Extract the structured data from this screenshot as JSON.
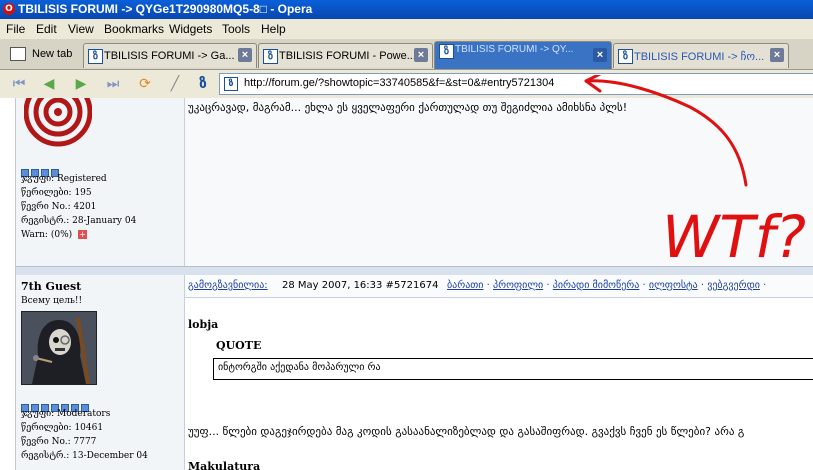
{
  "window": {
    "title": "TBILISIS FORUMI -> QYGe1T290980MQ5-8□ - Opera"
  },
  "menu": [
    "File",
    "Edit",
    "View",
    "Bookmarks",
    "Widgets",
    "Tools",
    "Help"
  ],
  "tabs": {
    "new_tab_label": "New tab",
    "items": [
      {
        "label": "TBILISIS FORUMI -> Ga..."
      },
      {
        "label": "TBILISIS FORUMI - Powe..."
      },
      {
        "label": "TBILISIS FORUMI -> QY..."
      },
      {
        "label": "TBILISIS FORUMI -> ჩო..."
      }
    ]
  },
  "address": {
    "url": "http://forum.ge/?showtopic=33740585&f=&st=0&#entry5721304"
  },
  "post1": {
    "text": "უკაცრავად, მაგრამ... ეხლა ეს ყველაფერი ქართულად თუ შეგიძლია ამიხსნა პლს!",
    "group": "ჯგუფი: Registered",
    "posts": "წერილები: 195",
    "member_no": "წევრი No.: 4201",
    "registered": "რეგისტრ.: 28-January 04",
    "warn": "Warn: (0%)"
  },
  "post2": {
    "username": "7th Guest",
    "user_title": "Всему цель!!",
    "group": "ჯგუფი: Moderators",
    "posts": "წერილები: 10461",
    "member_no": "წევრი No.: 7777",
    "registered": "რეგისტრ.: 13-December 04",
    "header_link": "გამოგზავნილია:",
    "date": "28 May 2007, 16:33  #5721674",
    "actions": [
      "ბარათი",
      "პროფილი",
      "პირადი მიმოწერა",
      "ილფოსტა",
      "ვებგვერდი"
    ],
    "quoted_user": "lobja",
    "quote_label": "QUOTE",
    "quote_text": "ინტორგში აქედანა მოპარული რა",
    "body": "უუფ... წლები დაგეჯირდება მაგ კოდის გასაანალიზებლად და გასაშიფრად. გვაქვს ჩვენ ეს წლები? არა გ",
    "next_user": "Makulatura"
  },
  "annotation": {
    "text": "WTf?",
    "color": "#e01010"
  }
}
